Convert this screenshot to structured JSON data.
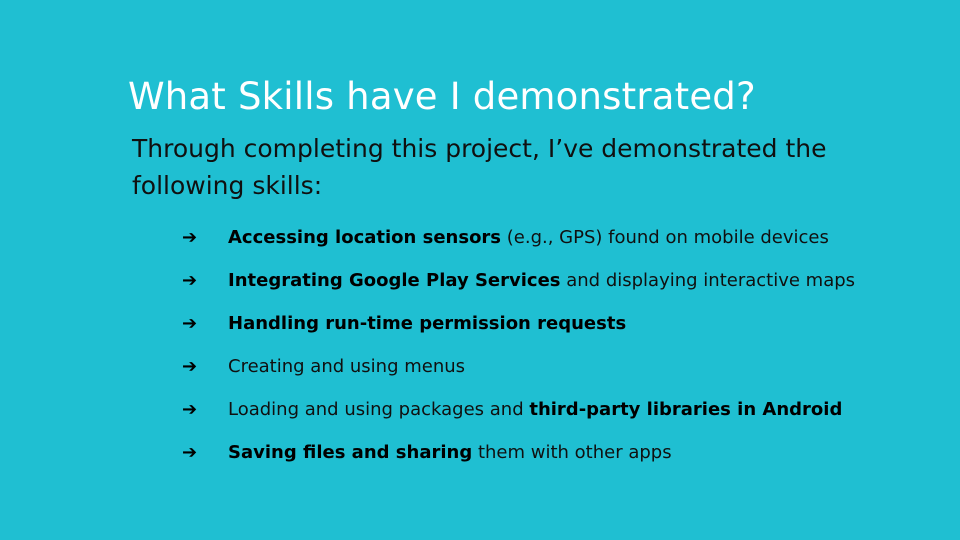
{
  "slide": {
    "background": "#1fbfd2",
    "title": "What Skills have I demonstrated?",
    "intro": "Through completing this project, I’ve demonstrated the following skills:",
    "bullet_icon": "right-arrow-icon",
    "bullet_glyph": "➔",
    "items": [
      {
        "strong_before": "Accessing location sensors",
        "plain": " (e.g., GPS) found on mobile devices",
        "strong_after": ""
      },
      {
        "strong_before": "Integrating Google Play Services",
        "plain": " and displaying interactive maps",
        "strong_after": ""
      },
      {
        "strong_before": "Handling run-time permission requests",
        "plain": "",
        "strong_after": ""
      },
      {
        "strong_before": "",
        "plain": "Creating and using menus",
        "strong_after": ""
      },
      {
        "strong_before": "",
        "plain": "Loading and using packages and ",
        "strong_after": "third-party libraries in Android"
      },
      {
        "strong_before": "Saving files and sharing",
        "plain": " them with other apps",
        "strong_after": ""
      }
    ]
  }
}
